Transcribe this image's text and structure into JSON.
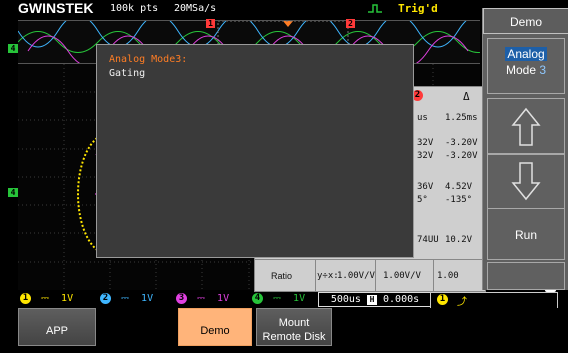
{
  "top_bar": {
    "brand": "GWINSTEK",
    "points": "100k pts",
    "sample_rate": "20MSa/s",
    "trigger_status": "Trig'd"
  },
  "dialog": {
    "title": "Analog Mode3:",
    "text": "Gating"
  },
  "side_menu": {
    "title": "Demo",
    "analog_label": "Analog",
    "mode_label": "Mode",
    "mode_value": "3",
    "up_icon": "up-arrow-icon",
    "down_icon": "down-arrow-icon",
    "run_label": "Run"
  },
  "measure_table": {
    "badge_2": "2",
    "delta": "Δ",
    "rows": [
      {
        "c1": "us",
        "c2": "1.25ms"
      },
      {
        "c1": "32V",
        "c2": "-3.20V"
      },
      {
        "c1": "32V",
        "c2": "-3.20V"
      },
      {
        "c1": "36V",
        "c2": "4.52V"
      },
      {
        "c1": "5°",
        "c2": "-135°"
      },
      {
        "c1": "74UU",
        "c2": "10.2V"
      }
    ],
    "ratio_label": "Ratio",
    "ratio_expr": "y÷x:",
    "ratio_v1": "1.00V/V",
    "ratio_v2": "1.00V/V",
    "ratio_v3": "1.00"
  },
  "channels": [
    {
      "num": "1",
      "scale": "1V",
      "color": "#ffe600"
    },
    {
      "num": "2",
      "scale": "1V",
      "color": "#3fb6ff"
    },
    {
      "num": "3",
      "scale": "1V",
      "color": "#e040e0"
    },
    {
      "num": "4",
      "scale": "1V",
      "color": "#27c43a"
    }
  ],
  "timebase": {
    "time": "500us",
    "h_label": "H",
    "offset": "0.000s"
  },
  "trigger_channel": "1",
  "f_label": "F",
  "bottom_menu": {
    "app": "APP",
    "demo": "Demo",
    "mount_line1": "Mount",
    "mount_line2": "Remote Disk"
  },
  "markers": {
    "ch4_label": "4",
    "pos_1": "1",
    "pos_2": "2"
  }
}
